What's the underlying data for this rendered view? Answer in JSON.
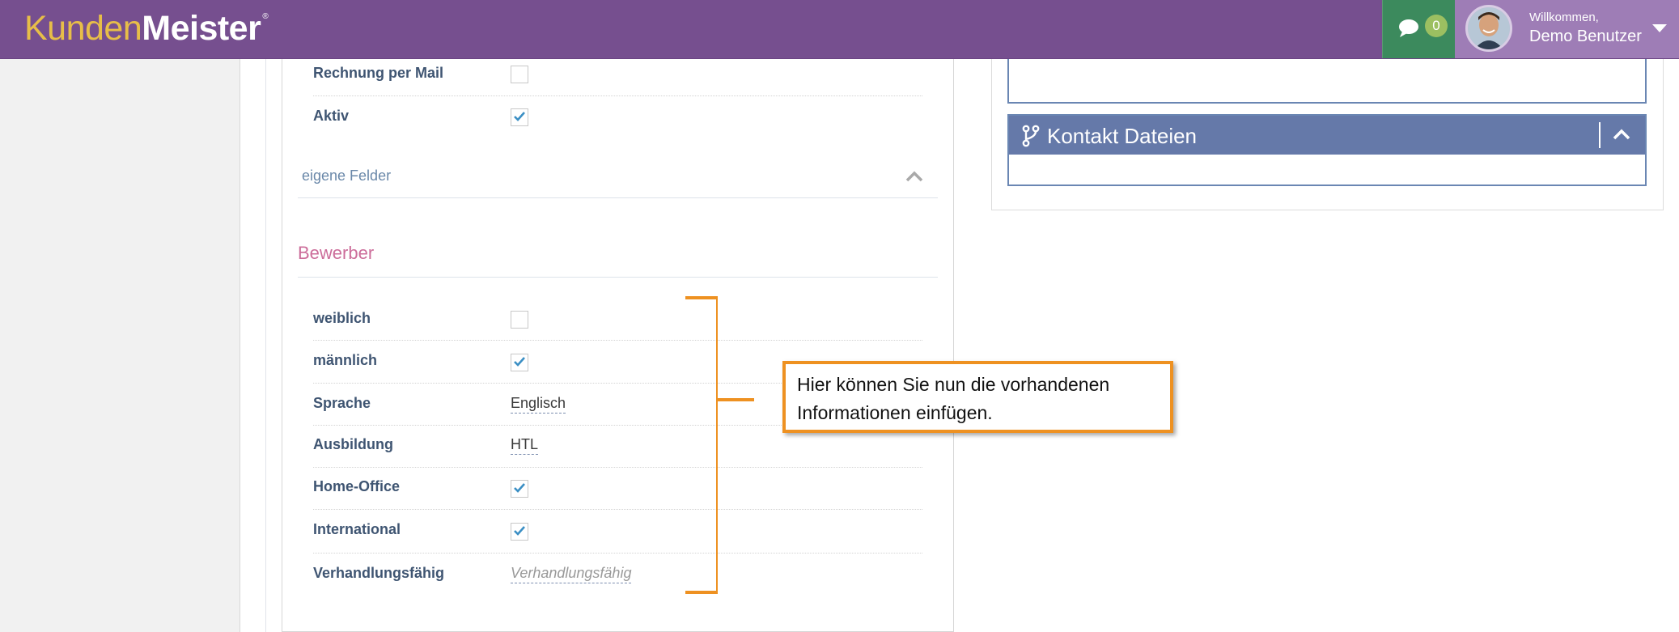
{
  "header": {
    "logo_part1": "Kunden",
    "logo_part2": "Meister",
    "logo_mark": "®",
    "messages_icon": "chat-bubble-icon",
    "messages_count": "0",
    "welcome": "Willkommen,",
    "user_name": "Demo Benutzer"
  },
  "form": {
    "top_rows": [
      {
        "label": "Rechnung per Mail",
        "checked": false
      },
      {
        "label": "Aktiv",
        "checked": true
      }
    ],
    "custom_fields_link": "eigene Felder",
    "section_title": "Bewerber",
    "rows": [
      {
        "label": "weiblich",
        "type": "checkbox",
        "checked": false
      },
      {
        "label": "männlich",
        "type": "checkbox",
        "checked": true
      },
      {
        "label": "Sprache",
        "type": "text",
        "value": "Englisch"
      },
      {
        "label": "Ausbildung",
        "type": "text",
        "value": "HTL"
      },
      {
        "label": "Home-Office",
        "type": "checkbox",
        "checked": true
      },
      {
        "label": "International",
        "type": "checkbox",
        "checked": true
      },
      {
        "label": "Verhandlungsfähig",
        "type": "empty",
        "value": "Verhandlungsfähig"
      }
    ]
  },
  "files_panel": {
    "title": "Kontakt Dateien",
    "icon": "branch-icon"
  },
  "callout": {
    "text": "Hier können Sie nun die vorhandenen Informationen einfügen."
  },
  "colors": {
    "navbar": "#764f8f",
    "messages_bg": "#3c8a5d",
    "user_bg": "#9e7db6",
    "panel_header": "#6579a9",
    "section_title": "#cc6d9a",
    "label": "#3f5572",
    "check": "#3b8fc4",
    "annotation": "#ee9121"
  }
}
